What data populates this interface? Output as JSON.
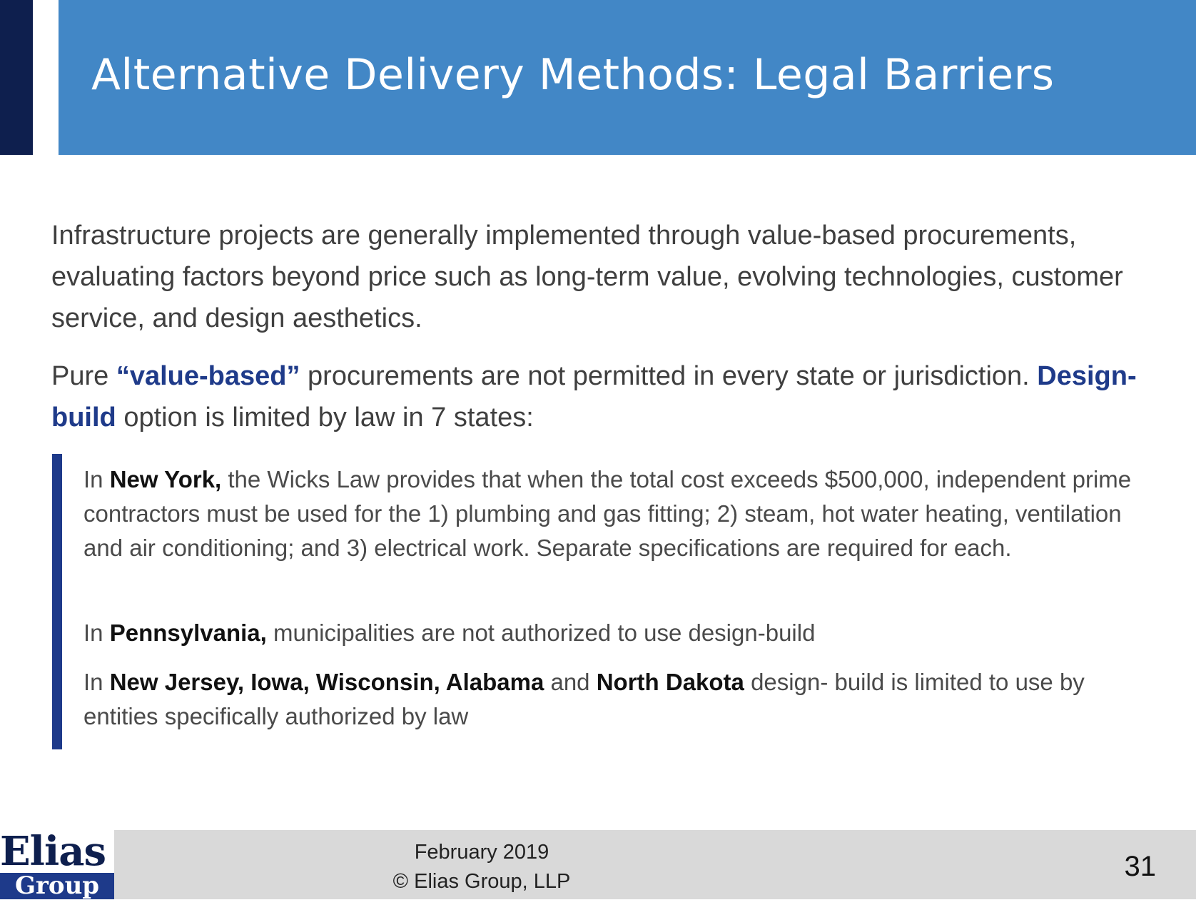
{
  "slide": {
    "title": "Alternative Delivery Methods: Legal Barriers",
    "intro": {
      "p1": "Infrastructure projects are generally implemented through value-based procurements, evaluating factors beyond price such as long-term value, evolving technologies, customer service,  and design aesthetics.",
      "p2_pre": "Pure ",
      "p2_quote": "“value-based”",
      "p2_mid": " procurements are not permitted in every state or jurisdiction. ",
      "p2_db": "Design-build",
      "p2_post": " option is limited by law in 7 states:"
    },
    "bullets": {
      "ny_pre": "In ",
      "ny_state": "New York,",
      "ny_text": " the Wicks Law provides that when the total cost exceeds $500,000, independent prime contractors must be used for the 1) plumbing and gas fitting; 2) steam, hot water heating, ventilation and air conditioning; and 3) electrical work. Separate specifications are required for each.",
      "pa_pre": "In ",
      "pa_state": "Pennsylvania,",
      "pa_text": " municipalities are not authorized to use design-build",
      "other_pre": "In ",
      "other_states1": "New Jersey, Iowa, Wisconsin, Alabama",
      "other_and": " and ",
      "other_states2": "North Dakota",
      "other_text": " design- build is limited to use by entities specifically authorized by law"
    }
  },
  "footer": {
    "logo_top": "Elias",
    "logo_bottom": "Group",
    "date": "February 2019",
    "copyright": "© Elias Group, LLP",
    "page_number": "31"
  },
  "colors": {
    "title_bar": "#4287c6",
    "accent_dark": "#0e1f4e",
    "highlight_blue": "#1f3b8a",
    "footer_gray": "#d9d9d9"
  }
}
